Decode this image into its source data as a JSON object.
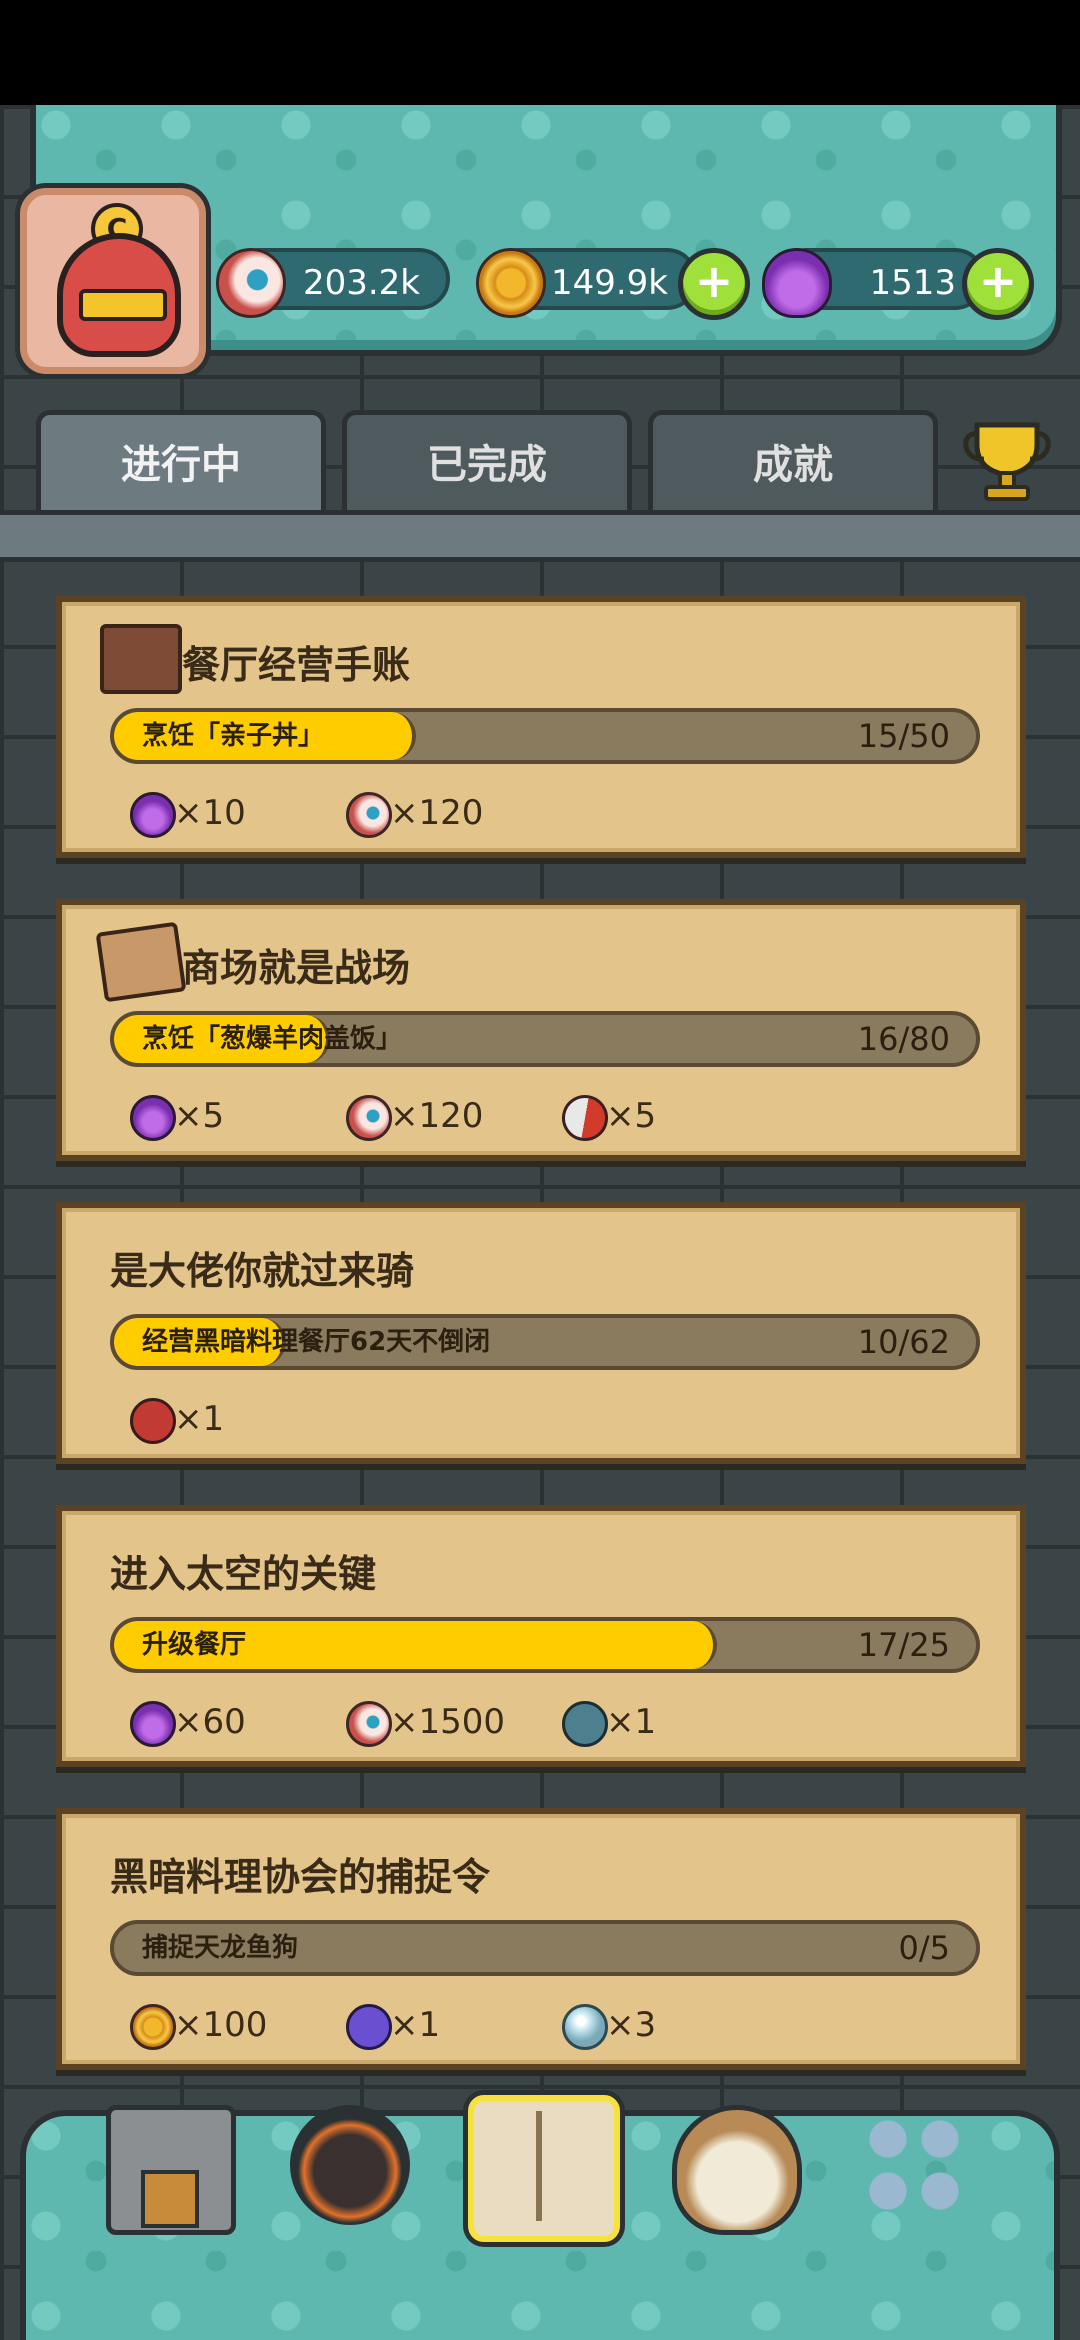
{
  "resources": {
    "eyes": "203.2k",
    "coins": "149.9k",
    "potions": "1513"
  },
  "avatar": {
    "badge": "C"
  },
  "tabs": [
    {
      "label": "进行中",
      "active": true
    },
    {
      "label": "已完成",
      "active": false
    },
    {
      "label": "成就",
      "active": false
    }
  ],
  "quests": [
    {
      "title": "餐厅经营手账",
      "icon": "ledger-book-icon",
      "task": "烹饪「亲子丼」",
      "progress": "15/50",
      "rewards": [
        {
          "icon": "potion-icon",
          "text": "×10"
        },
        {
          "icon": "eyeball-icon",
          "text": "×120"
        }
      ]
    },
    {
      "title": "商场就是战场",
      "icon": "battle-map-icon",
      "task": "烹饪「葱爆羊肉盖饭」",
      "progress": "16/80",
      "rewards": [
        {
          "icon": "potion-icon",
          "text": "×5"
        },
        {
          "icon": "eyeball-icon",
          "text": "×120"
        },
        {
          "icon": "capsule-icon",
          "text": "×5"
        }
      ]
    },
    {
      "title": "是大佬你就过来骑",
      "task": "经营黑暗料理餐厅62天不倒闭",
      "progress": "10/62",
      "rewards": [
        {
          "icon": "monster-mount-icon",
          "text": "×1"
        }
      ]
    },
    {
      "title": "进入太空的关键",
      "task": "升级餐厅",
      "progress": "17/25",
      "rewards": [
        {
          "icon": "potion-icon",
          "text": "×60"
        },
        {
          "icon": "eyeball-icon",
          "text": "×1500"
        },
        {
          "icon": "emblem-icon",
          "text": "×1"
        }
      ]
    },
    {
      "title": "黑暗料理协会的捕捉令",
      "task": "捕捉天龙鱼狗",
      "progress": "0/5",
      "rewards": [
        {
          "icon": "coin-icon",
          "text": "×100"
        },
        {
          "icon": "crystal-icon",
          "text": "×1"
        },
        {
          "icon": "pearl-icon",
          "text": "×3"
        }
      ]
    }
  ],
  "bottom_nav": [
    "restaurant-icon",
    "monster-icon",
    "quest-book-icon",
    "money-bag-icon",
    "menu-grid-icon"
  ]
}
